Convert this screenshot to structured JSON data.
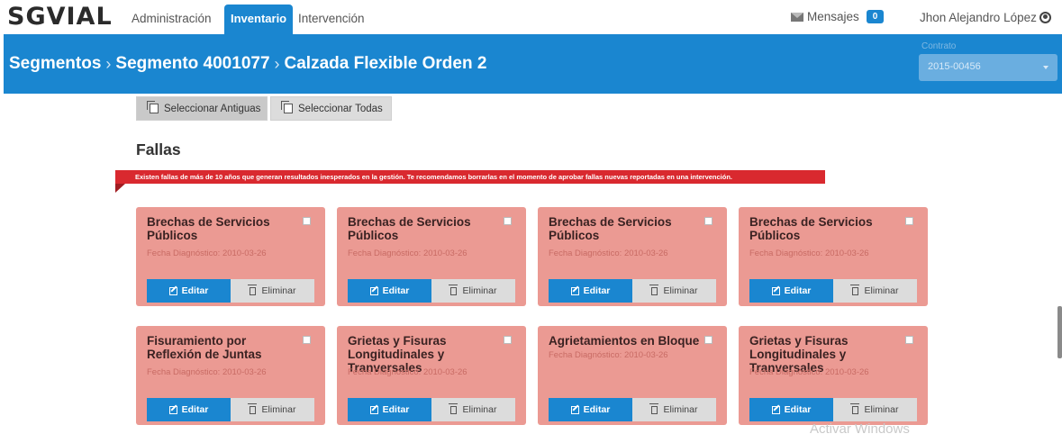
{
  "topnav": {
    "logo": "SGVIAL",
    "items": [
      "Administración",
      "Inventario",
      "Intervención"
    ],
    "messages_label": "Mensajes",
    "messages_count": "0",
    "user_name": "Jhon Alejandro López"
  },
  "header": {
    "breadcrumbs": [
      "Segmentos",
      "Segmento 4001077",
      "Calzada Flexible Orden 2"
    ],
    "contract_label": "Contrato",
    "contract_value": "2015-00456"
  },
  "buttons": {
    "select_old": "Seleccionar Antiguas",
    "select_all": "Seleccionar Todas"
  },
  "section": {
    "title": "Fallas",
    "alert": "Existen fallas de más de 10 años que generan resultados inesperados en la gestión. Te recomendamos borrarlas en el momento de aprobar fallas nuevas reportadas en una intervención."
  },
  "cards": [
    {
      "title": "Brechas de Servicios Públicos",
      "date": "Fecha Diagnóstico: 2010-03-26",
      "edit": "Editar",
      "delete": "Eliminar"
    },
    {
      "title": "Brechas de Servicios Públicos",
      "date": "Fecha Diagnóstico: 2010-03-26",
      "edit": "Editar",
      "delete": "Eliminar"
    },
    {
      "title": "Brechas de Servicios Públicos",
      "date": "Fecha Diagnóstico: 2010-03-26",
      "edit": "Editar",
      "delete": "Eliminar"
    },
    {
      "title": "Brechas de Servicios Públicos",
      "date": "Fecha Diagnóstico: 2010-03-26",
      "edit": "Editar",
      "delete": "Eliminar"
    },
    {
      "title": "Fisuramiento por Reflexión de Juntas",
      "date": "Fecha Diagnóstico: 2010-03-26",
      "edit": "Editar",
      "delete": "Eliminar"
    },
    {
      "title": "Grietas y Fisuras Longitudinales y Tranversales",
      "date": "Fecha Diagnóstico: 2010-03-26",
      "edit": "Editar",
      "delete": "Eliminar"
    },
    {
      "title": "Agrietamientos en Bloque",
      "date": "Fecha Diagnóstico: 2010-03-26",
      "edit": "Editar",
      "delete": "Eliminar"
    },
    {
      "title": "Grietas y Fisuras Longitudinales y Tranversales",
      "date": "Fecha Diagnóstico: 2010-03-26",
      "edit": "Editar",
      "delete": "Eliminar"
    }
  ],
  "watermark": "Activar Windows"
}
